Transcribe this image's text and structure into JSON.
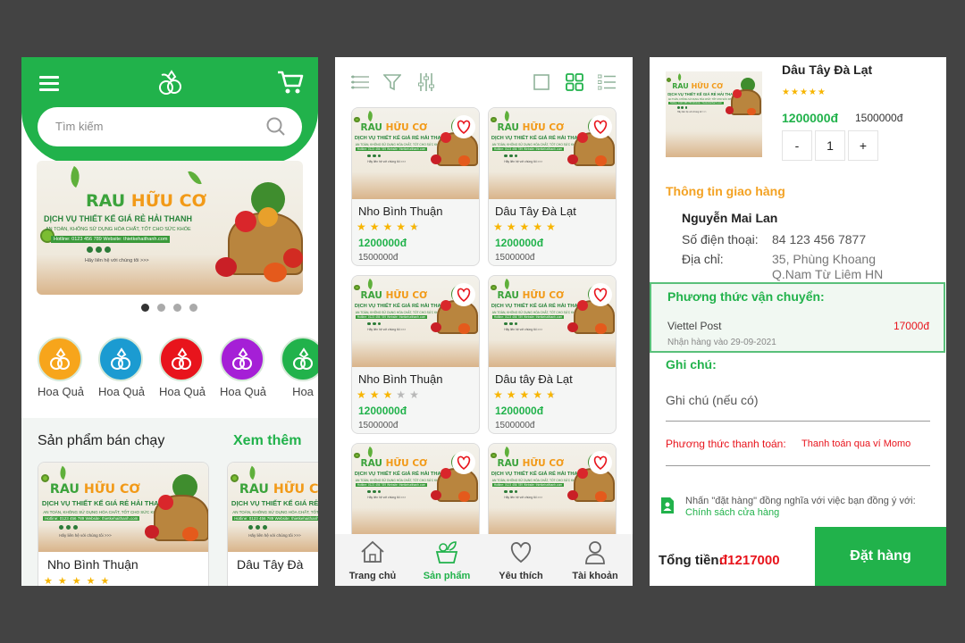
{
  "screen1": {
    "search_placeholder": "Tìm kiếm",
    "banner": {
      "title_a": "RAU ",
      "title_b": "HỮU CƠ",
      "subtitle": "DỊCH VỤ THIẾT KẾ GIÁ RẺ HẢI THANH",
      "tagline": "AN TOÀN, KHÔNG SỬ DỤNG HÓA CHẤT, TỐT CHO SỨC KHỎE",
      "hotline": "Hotline: 0123 456 789 Website: thietkehaithanh.com",
      "contact": "Hãy liên hệ với chúng tôi >>>"
    },
    "carousel_dots": 4,
    "carousel_active": 0,
    "categories": [
      {
        "label": "Hoa Quả",
        "color": "#f7a51b"
      },
      {
        "label": "Hoa Quả",
        "color": "#1b9bd1"
      },
      {
        "label": "Hoa Quả",
        "color": "#e8141c"
      },
      {
        "label": "Hoa Quả",
        "color": "#a51fd6"
      },
      {
        "label": "Hoa",
        "color": "#21b24b"
      }
    ],
    "best_sellers_title": "Sản phẩm bán chạy",
    "see_more": "Xem thêm",
    "best_sellers": [
      {
        "name": "Nho Bình Thuận",
        "rating": 4.5
      },
      {
        "name": "Dâu Tây Đà",
        "rating": 0
      }
    ]
  },
  "screen2": {
    "products": [
      {
        "name": "Nho Bình Thuận",
        "rating": 4.5,
        "price": "1200000đ",
        "old_price": "1500000đ"
      },
      {
        "name": "Dâu Tây Đà Lạt",
        "rating": 5,
        "price": "1200000đ",
        "old_price": "1500000đ"
      },
      {
        "name": "Nho Bình Thuận",
        "rating": 3,
        "price": "1200000đ",
        "old_price": "1500000đ"
      },
      {
        "name": "Dâu tây Đà Lạt",
        "rating": 4.5,
        "price": "1200000đ",
        "old_price": "1500000đ"
      },
      {
        "name": "",
        "rating": 0,
        "price": "",
        "old_price": ""
      },
      {
        "name": "",
        "rating": 0,
        "price": "",
        "old_price": ""
      }
    ],
    "tabs": [
      {
        "label": "Trang chủ",
        "icon": "home-icon",
        "active": false
      },
      {
        "label": "Sản phẩm",
        "icon": "vegetable-basket-icon",
        "active": true
      },
      {
        "label": "Yêu thích",
        "icon": "heart-icon",
        "active": false
      },
      {
        "label": "Tài khoản",
        "icon": "user-icon",
        "active": false
      }
    ]
  },
  "screen3": {
    "product_name": "Dâu Tây Đà Lạt",
    "rating": 5,
    "price": "1200000đ",
    "old_price": "1500000đ",
    "qty_minus": "-",
    "quantity": "1",
    "qty_plus": "+",
    "shipping_info_title": "Thông tin giao hàng",
    "recipient_name": "Nguyễn Mai Lan",
    "phone_label": "Số điện thoại:",
    "phone": "84 123 456 7877",
    "address_label": "Địa chỉ:",
    "address_line1": "35, Phùng Khoang",
    "address_line2": "Q.Nam Từ Liêm HN",
    "shipping_method_title": "Phương thức vận chuyển:",
    "carrier": "Viettel Post",
    "shipping_fee": "17000đ",
    "delivery_date": "Nhận hàng vào 29-09-2021",
    "note_title": "Ghi chú:",
    "note_placeholder": "Ghi chú (nếu có)",
    "payment_label": "Phương thức thanh toán:",
    "payment_value": "Thanh toán qua ví Momo",
    "policy_text": "Nhấn \"đặt hàng\" đồng nghĩa với việc bạn đồng ý với:",
    "policy_link": "Chính sách cửa hàng",
    "total_label": "Tổng tiền:",
    "total_value": "đ1217000",
    "order_button": "Đặt hàng"
  },
  "colors": {
    "brand_green": "#21b24b",
    "accent_orange": "#f7a51b",
    "price_red": "#e8141c",
    "background": "#434343"
  }
}
